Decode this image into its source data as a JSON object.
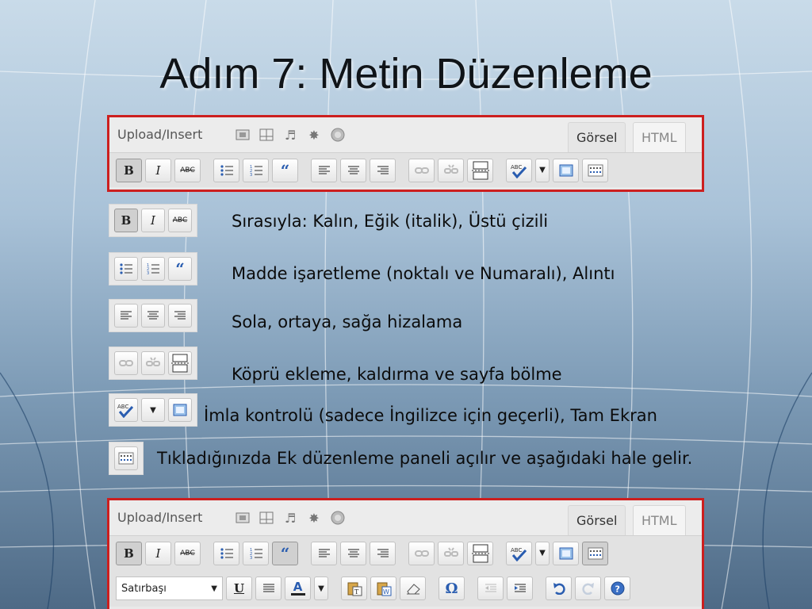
{
  "slide": {
    "title": "Adım 7: Metin Düzenleme"
  },
  "editor": {
    "upload_label": "Upload/Insert",
    "media_icons": [
      "image-icon",
      "video-icon",
      "music-icon",
      "media-star-icon",
      "circle-icon"
    ],
    "tabs": {
      "visual": "Görsel",
      "html": "HTML"
    },
    "buttons": {
      "bold": "B",
      "italic": "I",
      "strike": "ABC",
      "underline": "U",
      "omega": "Ω"
    },
    "format_select": "Satırbaşı"
  },
  "legend": [
    {
      "text": "Sırasıyla: Kalın, Eğik (italik), Üstü çizili"
    },
    {
      "text": "Madde işaretleme (noktalı ve Numaralı), Alıntı"
    },
    {
      "text": "Sola, ortaya, sağa hizalama"
    },
    {
      "text": "Köprü ekleme, kaldırma ve sayfa bölme"
    },
    {
      "text": "İmla kontrolü (sadece İngilizce için geçerli), Tam Ekran"
    },
    {
      "text": "Tıkladığınızda Ek düzenleme paneli açılır ve aşağıdaki hale gelir."
    }
  ],
  "colors": {
    "highlight_border": "#cc1f1f",
    "toolbar_bg": "#e2e2e2"
  }
}
